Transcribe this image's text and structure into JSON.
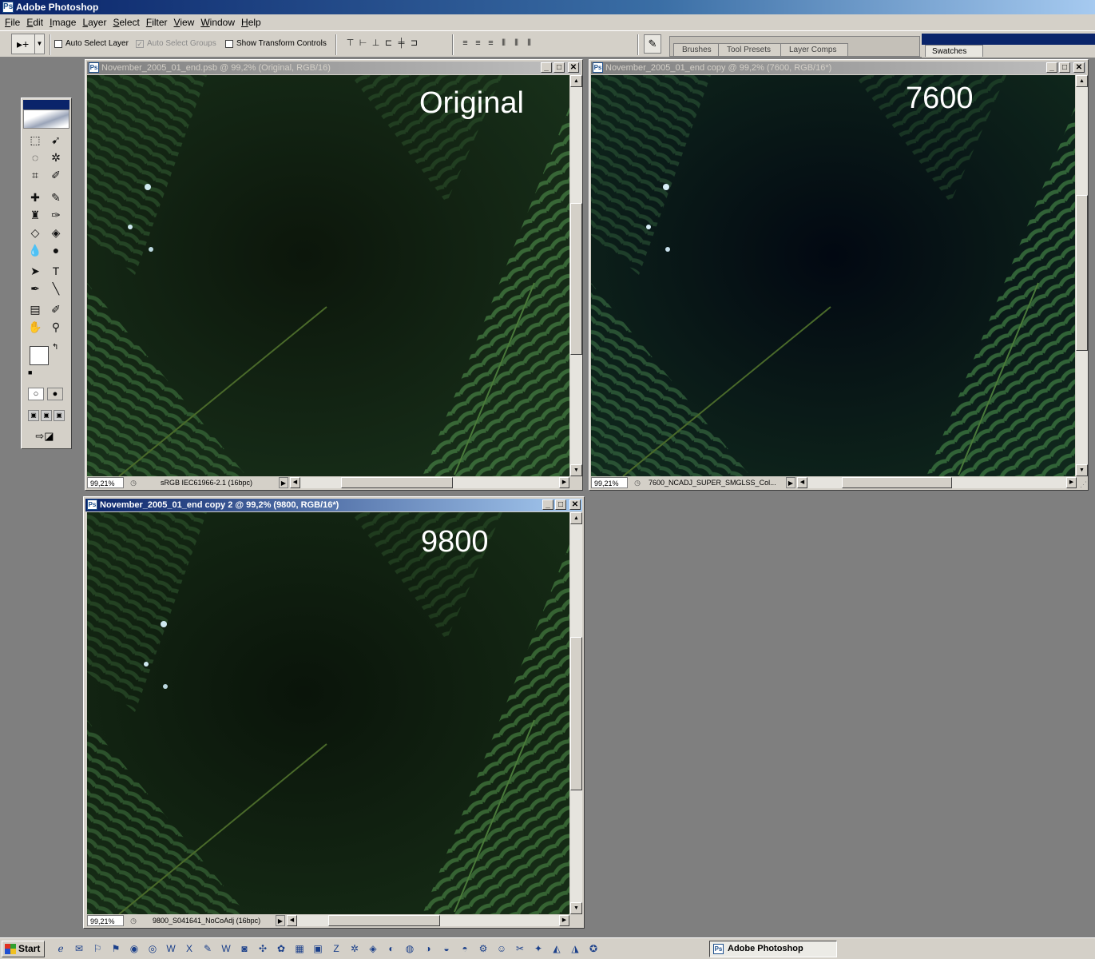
{
  "app": {
    "title": "Adobe Photoshop",
    "icon": "photoshop-icon"
  },
  "menu": [
    "File",
    "Edit",
    "Image",
    "Layer",
    "Select",
    "Filter",
    "View",
    "Window",
    "Help"
  ],
  "options": {
    "tool_glyph": "▸+",
    "auto_select_layer": "Auto Select Layer",
    "auto_select_groups": "Auto Select Groups",
    "show_transform_controls": "Show Transform Controls",
    "auto_select_layer_checked": false,
    "auto_select_groups_checked": true,
    "show_transform_controls_checked": false
  },
  "palette_well": {
    "tabs": [
      "Brushes",
      "Tool Presets",
      "Layer Comps"
    ]
  },
  "swatches": {
    "tab": "Swatches"
  },
  "documents": {
    "original": {
      "title": "November_2005_01_end.psb @ 99,2% (Original, RGB/16)",
      "label": "Original",
      "zoom": "99,21%",
      "status": "sRGB IEC61966-2.1 (16bpc)",
      "active": false
    },
    "copy1": {
      "title": "November_2005_01_end copy @ 99,2% (7600, RGB/16*)",
      "label": "7600",
      "zoom": "99,21%",
      "status": "7600_NCADJ_SUPER_SMGLSS_Col...",
      "active": false
    },
    "copy2": {
      "title": "November_2005_01_end copy 2 @ 99,2% (9800, RGB/16*)",
      "label": "9800",
      "zoom": "99,21%",
      "status": "9800_S041641_NoCoAdj (16bpc)",
      "active": true
    }
  },
  "taskbar": {
    "start": "Start",
    "task": "Adobe Photoshop",
    "quick_launch_icons": [
      "ie-icon",
      "outlook-icon",
      "acrobat-icon",
      "acrobat-reader-icon",
      "firefox-icon",
      "thunderbird-icon",
      "word-icon",
      "excel-icon",
      "notepad-icon",
      "word-doc-icon",
      "app-icon",
      "app-icon",
      "paint-icon",
      "folder-icon",
      "save-icon",
      "filezilla-icon",
      "app-icon"
    ]
  },
  "colors": {
    "title_active": "#0a246a",
    "chrome": "#d4d0c8",
    "desktop": "#7f7f7f",
    "foliage": "#2f5a2e"
  }
}
